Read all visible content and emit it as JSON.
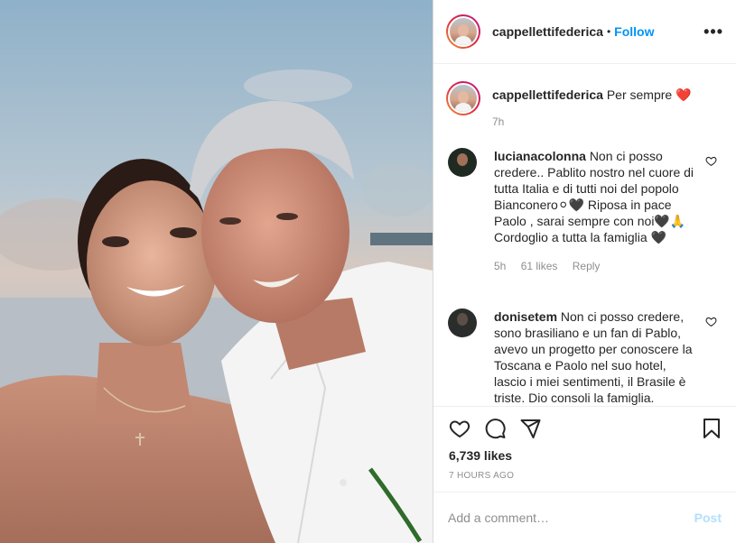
{
  "post": {
    "username": "cappellettifederica",
    "follow_label": "Follow",
    "dot": "•",
    "more_label": "•••"
  },
  "caption": {
    "username": "cappellettifederica",
    "text": "Per sempre",
    "emoji": "❤️",
    "time": "7h"
  },
  "comments": [
    {
      "username": "lucianacolonna",
      "text": "Non ci posso credere.. Pablito nostro nel cuore di tutta Italia e di tutti noi del popolo Bianconero⚪🖤 Riposa in pace Paolo , sarai sempre con noi🖤🙏 Cordoglio a tutta la famiglia 🖤",
      "time": "5h",
      "likes": "61 likes",
      "reply": "Reply"
    },
    {
      "username": "donisetem",
      "text": "Non ci posso credere, sono brasiliano e un fan di Pablo, avevo un progetto per conoscere la Toscana e Paolo nel suo hotel, lascio i miei sentimenti, il Brasile è triste. Dio consoli la famiglia."
    }
  ],
  "actions": {
    "likes": "6,739 likes",
    "ago": "7 HOURS AGO"
  },
  "add_comment": {
    "placeholder": "Add a comment…",
    "post_label": "Post"
  },
  "icons": [
    "heart-icon",
    "comment-icon",
    "share-icon",
    "bookmark-icon",
    "like-comment-icon",
    "more-icon"
  ],
  "colors": {
    "accent": "#0095f6",
    "post_disabled": "#b2dffc",
    "muted": "#8e8e8e"
  }
}
